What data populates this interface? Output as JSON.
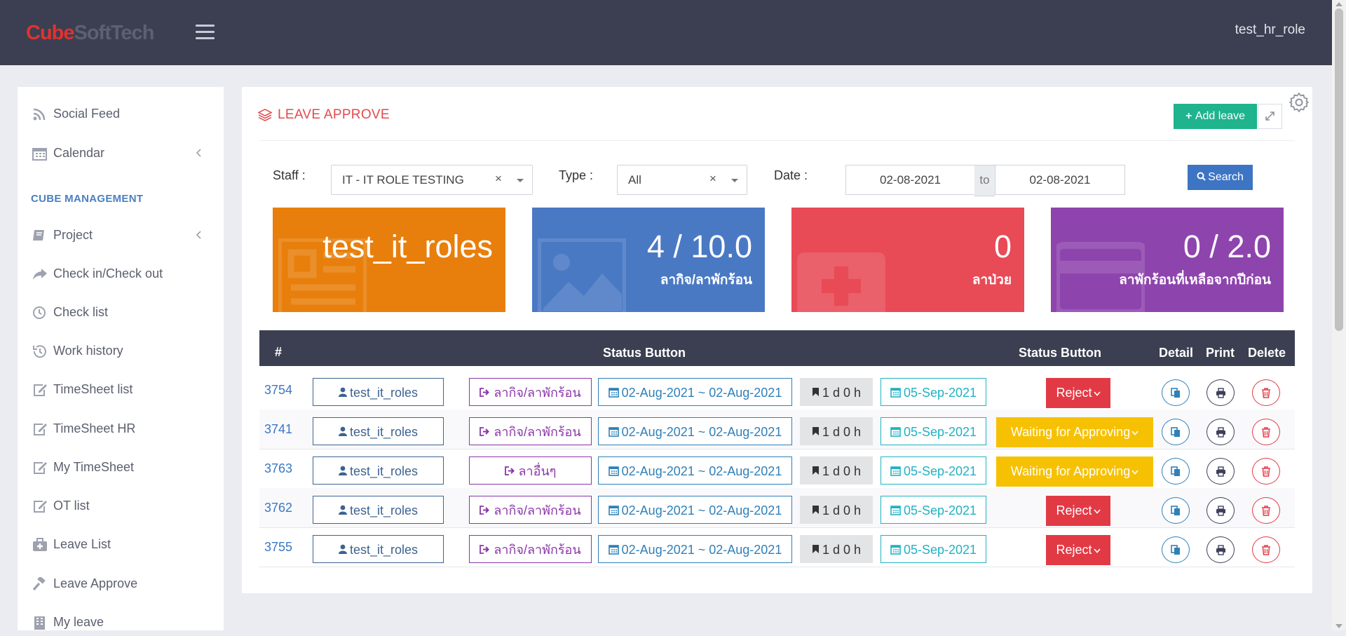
{
  "app": {
    "logo_part1": "Cube",
    "logo_part2": "SoftTech",
    "username": "test_hr_role"
  },
  "sidebar": {
    "section_title": "CUBE MANAGEMENT",
    "items": [
      {
        "label": "Social Feed",
        "icon": "rss-icon"
      },
      {
        "label": "Calendar",
        "icon": "calendar-icon",
        "expandable": true
      },
      {
        "label": "Project",
        "icon": "book-icon",
        "expandable": true
      },
      {
        "label": "Check in/Check out",
        "icon": "share-arrow-icon"
      },
      {
        "label": "Check list",
        "icon": "clock-icon"
      },
      {
        "label": "Work history",
        "icon": "history-icon"
      },
      {
        "label": "TimeSheet list",
        "icon": "edit-icon"
      },
      {
        "label": "TimeSheet HR",
        "icon": "edit-icon"
      },
      {
        "label": "My TimeSheet",
        "icon": "edit-icon"
      },
      {
        "label": "OT list",
        "icon": "edit-icon"
      },
      {
        "label": "Leave List",
        "icon": "medkit-icon"
      },
      {
        "label": "Leave Approve",
        "icon": "gavel-icon"
      },
      {
        "label": "My leave",
        "icon": "building-icon"
      }
    ]
  },
  "panel": {
    "title": "LEAVE APPROVE",
    "add_leave_label": "Add leave"
  },
  "filters": {
    "staff_label": "Staff :",
    "staff_value": "IT - IT ROLE TESTING",
    "type_label": "Type :",
    "type_value": "All",
    "date_label": "Date :",
    "date_from": "02-08-2021",
    "date_to_label": "to",
    "date_to": "02-08-2021",
    "search_label": "Search"
  },
  "cards": [
    {
      "value": "test_it_roles",
      "caption": "",
      "color": "#e87f0c"
    },
    {
      "value": "4 / 10.0",
      "caption": "ลากิจ/ลาพักร้อน",
      "color": "#4a79c4"
    },
    {
      "value": "0",
      "caption": "ลาป่วย",
      "color": "#e84a56"
    },
    {
      "value": "0 / 2.0",
      "caption": "ลาพักร้อนที่เหลือจากปีก่อน",
      "color": "#8e44ad"
    }
  ],
  "table": {
    "headers": {
      "id": "#",
      "status1": "Status Button",
      "status2": "Status Button",
      "detail": "Detail",
      "print": "Print",
      "delete": "Delete"
    },
    "rows": [
      {
        "id": "3754",
        "user": "test_it_roles",
        "type": "ลากิจ/ลาพักร้อน",
        "range": "02-Aug-2021 ~ 02-Aug-2021",
        "duration": "1 d 0 h",
        "date": "05-Sep-2021",
        "status": "Reject",
        "status_kind": "reject"
      },
      {
        "id": "3741",
        "user": "test_it_roles",
        "type": "ลากิจ/ลาพักร้อน",
        "range": "02-Aug-2021 ~ 02-Aug-2021",
        "duration": "1 d 0 h",
        "date": "05-Sep-2021",
        "status": "Waiting for Approving",
        "status_kind": "wait"
      },
      {
        "id": "3763",
        "user": "test_it_roles",
        "type": "ลาอื่นๆ",
        "range": "02-Aug-2021 ~ 02-Aug-2021",
        "duration": "1 d 0 h",
        "date": "05-Sep-2021",
        "status": "Waiting for Approving",
        "status_kind": "wait"
      },
      {
        "id": "3762",
        "user": "test_it_roles",
        "type": "ลากิจ/ลาพักร้อน",
        "range": "02-Aug-2021 ~ 02-Aug-2021",
        "duration": "1 d 0 h",
        "date": "05-Sep-2021",
        "status": "Reject",
        "status_kind": "reject"
      },
      {
        "id": "3755",
        "user": "test_it_roles",
        "type": "ลากิจ/ลาพักร้อน",
        "range": "02-Aug-2021 ~ 02-Aug-2021",
        "duration": "1 d 0 h",
        "date": "05-Sep-2021",
        "status": "Reject",
        "status_kind": "reject"
      }
    ]
  }
}
